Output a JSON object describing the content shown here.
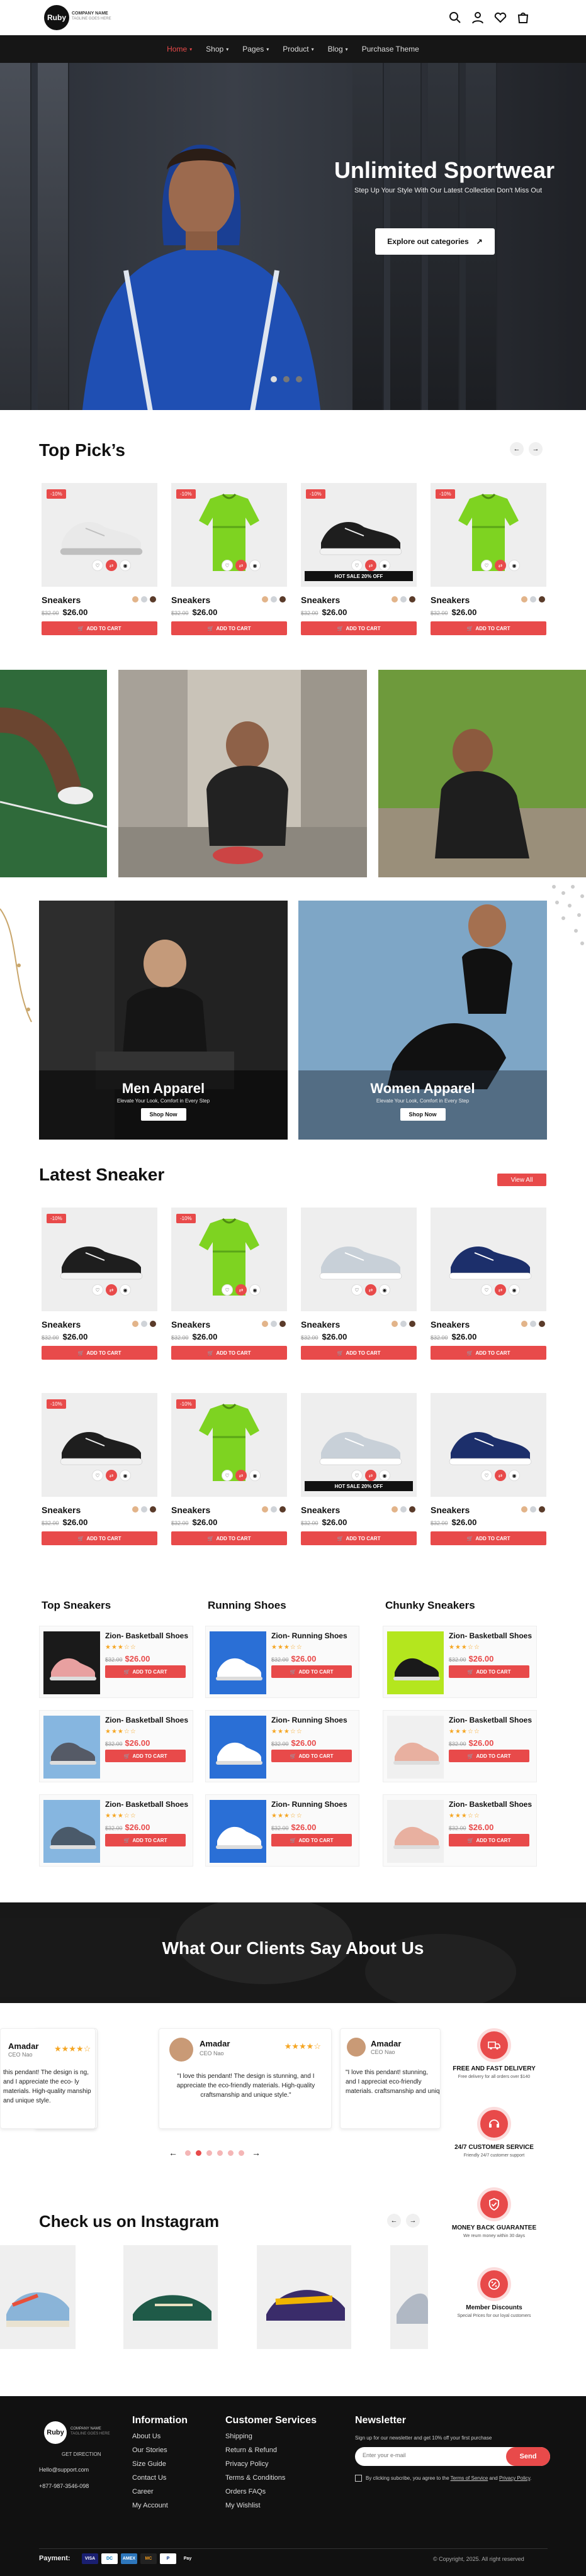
{
  "brand": {
    "logo_text": "Ruby",
    "company_name": "COMPANY NAME",
    "tagline": "TAGLINE GOES HERE",
    "accent": "#e84a4a"
  },
  "header": {
    "icons": [
      "search-icon",
      "user-icon",
      "heart-icon",
      "bag-icon"
    ]
  },
  "nav": {
    "items": [
      {
        "label": "Home",
        "dropdown": true,
        "active": true
      },
      {
        "label": "Shop",
        "dropdown": true
      },
      {
        "label": "Pages",
        "dropdown": true
      },
      {
        "label": "Product",
        "dropdown": true
      },
      {
        "label": "Blog",
        "dropdown": true
      },
      {
        "label": "Purchase Theme",
        "dropdown": false
      }
    ]
  },
  "hero": {
    "title": "Unlimited Sportwear",
    "subtitle": "Step Up Your Style With Our Latest Collection Don't Miss Out",
    "button": "Explore out categories",
    "slides": 3,
    "active_slide": 0
  },
  "top_picks": {
    "title": "Top Pick’s",
    "products": [
      {
        "name": "Sneakers",
        "old_price": "$32.00",
        "price": "$26.00",
        "badge": "-10%",
        "add": "ADD TO CART",
        "kind": "white-shoe",
        "hot": ""
      },
      {
        "name": "Sneakers",
        "old_price": "$32.00",
        "price": "$26.00",
        "badge": "-10%",
        "add": "ADD TO CART",
        "kind": "green-shirt",
        "hot": ""
      },
      {
        "name": "Sneakers",
        "old_price": "$32.00",
        "price": "$26.00",
        "badge": "-10%",
        "add": "ADD TO CART",
        "kind": "black-shoe",
        "hot": "HOT SALE 20% OFF"
      },
      {
        "name": "Sneakers",
        "old_price": "$32.00",
        "price": "$26.00",
        "badge": "-10%",
        "add": "ADD TO CART",
        "kind": "green-shirt",
        "hot": ""
      }
    ]
  },
  "apparel": [
    {
      "title": "Men Apparel",
      "subtitle": "Elevate Your Look, Comfort in Every Step",
      "button": "Shop Now"
    },
    {
      "title": "Women Apparel",
      "subtitle": "Elevate Your Look, Comfort in Every Step",
      "button": "Shop Now"
    }
  ],
  "latest": {
    "title": "Latest Sneaker",
    "view_all": "View All",
    "products": [
      {
        "name": "Sneakers",
        "old_price": "$32.00",
        "price": "$26.00",
        "badge": "-10%",
        "add": "ADD TO CART",
        "kind": "black-shoe",
        "hot": ""
      },
      {
        "name": "Sneakers",
        "old_price": "$32.00",
        "price": "$26.00",
        "badge": "-10%",
        "add": "ADD TO CART",
        "kind": "green-shirt",
        "hot": ""
      },
      {
        "name": "Sneakers",
        "old_price": "$32.00",
        "price": "$26.00",
        "badge": "",
        "add": "ADD TO CART",
        "kind": "grey-shoe",
        "hot": ""
      },
      {
        "name": "Sneakers",
        "old_price": "$32.00",
        "price": "$26.00",
        "badge": "",
        "add": "ADD TO CART",
        "kind": "navy-shoe",
        "hot": ""
      },
      {
        "name": "Sneakers",
        "old_price": "$32.00",
        "price": "$26.00",
        "badge": "-10%",
        "add": "ADD TO CART",
        "kind": "black-shoe",
        "hot": ""
      },
      {
        "name": "Sneakers",
        "old_price": "$32.00",
        "price": "$26.00",
        "badge": "-10%",
        "add": "ADD TO CART",
        "kind": "green-shirt",
        "hot": ""
      },
      {
        "name": "Sneakers",
        "old_price": "$32.00",
        "price": "$26.00",
        "badge": "",
        "add": "ADD TO CART",
        "kind": "grey-shoe",
        "hot": "HOT SALE 20% OFF"
      },
      {
        "name": "Sneakers",
        "old_price": "$32.00",
        "price": "$26.00",
        "badge": "",
        "add": "ADD TO CART",
        "kind": "navy-shoe",
        "hot": ""
      }
    ]
  },
  "categories": [
    {
      "title": "Top Sneakers",
      "items": [
        {
          "name": "Zion- Basketball Shoes",
          "old_price": "$32.00",
          "price": "$26.00",
          "add": "ADD TO CART",
          "bg": "#1a1a1a",
          "shoe": "#e8a0a0"
        },
        {
          "name": "Zion- Basketball Shoes",
          "old_price": "$32.00",
          "price": "$26.00",
          "add": "ADD TO CART",
          "bg": "#86b6e0",
          "shoe": "#555a66"
        },
        {
          "name": "Zion- Basketball Shoes",
          "old_price": "$32.00",
          "price": "$26.00",
          "add": "ADD TO CART",
          "bg": "#86b6e0",
          "shoe": "#4a5a6a"
        }
      ]
    },
    {
      "title": "Running Shoes",
      "items": [
        {
          "name": "Zion- Running Shoes",
          "old_price": "$32.00",
          "price": "$26.00",
          "add": "ADD TO CART",
          "bg": "#2a6fd6",
          "shoe": "#ffffff"
        },
        {
          "name": "Zion- Running Shoes",
          "old_price": "$32.00",
          "price": "$26.00",
          "add": "ADD TO CART",
          "bg": "#2a6fd6",
          "shoe": "#ffffff"
        },
        {
          "name": "Zion- Running Shoes",
          "old_price": "$32.00",
          "price": "$26.00",
          "add": "ADD TO CART",
          "bg": "#2a6fd6",
          "shoe": "#ffffff"
        }
      ]
    },
    {
      "title": "Chunky Sneakers",
      "items": [
        {
          "name": "Zion- Basketball Shoes",
          "old_price": "$32.00",
          "price": "$26.00",
          "add": "ADD TO CART",
          "bg": "#b4e61e",
          "shoe": "#1a1a1a"
        },
        {
          "name": "Zion- Basketball Shoes",
          "old_price": "$32.00",
          "price": "$26.00",
          "add": "ADD TO CART",
          "bg": "#f0f0f0",
          "shoe": "#e8b0a0"
        },
        {
          "name": "Zion- Basketball Shoes",
          "old_price": "$32.00",
          "price": "$26.00",
          "add": "ADD TO CART",
          "bg": "#f0f0f0",
          "shoe": "#e8b0a0"
        }
      ]
    }
  ],
  "clients": {
    "title": "What Our Clients Say About Us",
    "testimonials": [
      {
        "name": "Amadar",
        "role": "CEO Nao",
        "text": "this pendant! The design is ng, and I appreciate the eco- ly materials. High-quality manship and unique style."
      },
      {
        "name": "Amadar",
        "role": "CEO Nao",
        "text": "\"I love this pendant! The design is stunning, and I appreciate the eco-friendly materials. High-quality craftsmanship and unique style.\""
      },
      {
        "name": "Amadar",
        "role": "CEO Nao",
        "text": "\"I love this pendant! stunning, and I appreciat eco-friendly materials. craftsmanship and uniq"
      }
    ],
    "dots": 6,
    "active_dot": 1
  },
  "features": [
    {
      "title": "FREE AND FAST DELIVERY",
      "sub": "Free delivery for all orders over $140",
      "icon": "truck-icon"
    },
    {
      "title": "24/7 CUSTOMER SERVICE",
      "sub": "Friendly 24/7 customer support",
      "icon": "headset-icon"
    },
    {
      "title": "MONEY BACK GUARANTEE",
      "sub": "We reurn money within 30 days",
      "icon": "shield-check-icon"
    },
    {
      "title": "Member Discounts",
      "sub": "Special Prices for our loyal customers",
      "icon": "discount-icon"
    }
  ],
  "instagram": {
    "title": "Check us on Instagram"
  },
  "footer": {
    "address": "GET DIRECTION",
    "email": "Hello@support.com",
    "phone": "+877-987-3546-098",
    "information": {
      "title": "Information",
      "links": [
        "About Us",
        "Our Stories",
        "Size Guide",
        "Contact Us",
        "Career",
        "My Account"
      ]
    },
    "services": {
      "title": "Customer Services",
      "links": [
        "Shipping",
        "Return & Refund",
        "Privacy Policy",
        "Terms & Conditions",
        "Orders FAQs",
        "My Wishlist"
      ]
    },
    "newsletter": {
      "title": "Newsletter",
      "text": "Sign up for our newsletter and get 10% off your first purchase",
      "placeholder": "Enter your e-mail",
      "button": "Send",
      "consent_pre": "By clicking subcribe, you agree to the ",
      "consent_link1": "Terms of Service",
      "consent_mid": " and ",
      "consent_link2": "Privacy Policy",
      "consent_end": "."
    },
    "payment_label": "Payment:",
    "payments": [
      "VISA",
      "DC",
      "AMEX",
      "MC",
      "P",
      "Pay"
    ],
    "copyright": "© Copyright, 2025. All right reserved"
  }
}
